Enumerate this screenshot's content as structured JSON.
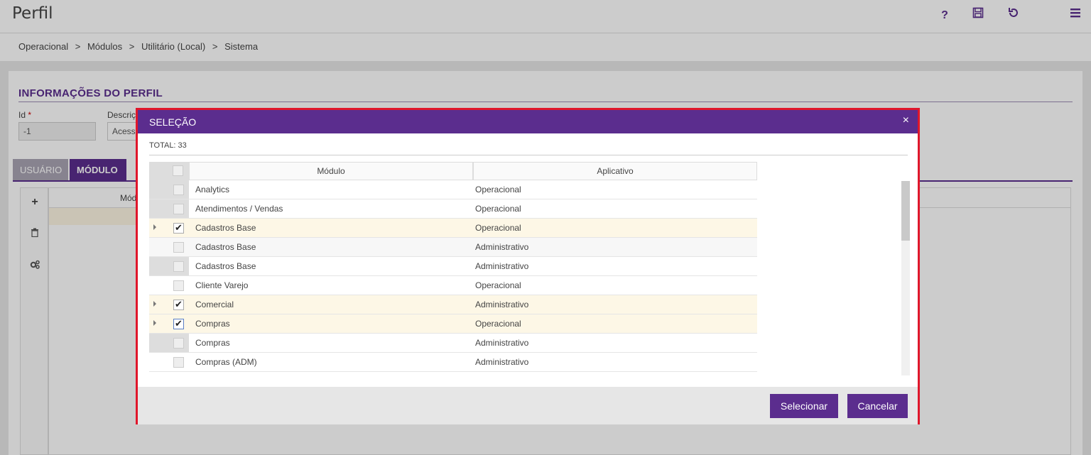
{
  "page": {
    "title": "Perfil"
  },
  "toolbar": {
    "help": "?",
    "save_icon": "save-icon",
    "refresh_icon": "refresh-icon",
    "menu_icon": "menu-icon"
  },
  "breadcrumb": [
    "Operacional",
    ">",
    "Módulos",
    ">",
    "Utilitário (Local)",
    ">",
    "Sistema"
  ],
  "form": {
    "section_title": "INFORMAÇÕES DO PERFIL",
    "id_label": "Id",
    "required_mark": "*",
    "id_value": "-1",
    "desc_label": "Descriç",
    "desc_value": "Acess"
  },
  "tabs": [
    {
      "label": "USUÁRIO"
    },
    {
      "label": "MÓDULO"
    }
  ],
  "bg_grid": {
    "header": "Mód"
  },
  "modal": {
    "title": "SELEÇÃO",
    "close": "×",
    "total": "TOTAL: 33",
    "columns": [
      "Módulo",
      "Aplicativo"
    ],
    "rows": [
      {
        "modulo": "Analytics",
        "aplicativo": "Operacional",
        "checked": false
      },
      {
        "modulo": "Atendimentos / Vendas",
        "aplicativo": "Operacional",
        "checked": false
      },
      {
        "modulo": "Cadastros Base",
        "aplicativo": "Operacional",
        "checked": true
      },
      {
        "modulo": "Cadastros Base",
        "aplicativo": "Administrativo",
        "checked": false
      },
      {
        "modulo": "Cadastros Base",
        "aplicativo": "Administrativo",
        "checked": false
      },
      {
        "modulo": "Cliente Varejo",
        "aplicativo": "Operacional",
        "checked": false
      },
      {
        "modulo": "Comercial",
        "aplicativo": "Administrativo",
        "checked": true
      },
      {
        "modulo": "Compras",
        "aplicativo": "Operacional",
        "checked": true
      },
      {
        "modulo": "Compras",
        "aplicativo": "Administrativo",
        "checked": false
      },
      {
        "modulo": "Compras (ADM)",
        "aplicativo": "Administrativo",
        "checked": false
      }
    ],
    "buttons": {
      "select": "Selecionar",
      "cancel": "Cancelar"
    },
    "colors": {
      "header": "#5b2d8e",
      "border": "#e0162b",
      "selected_row": "#fdf7e6"
    }
  }
}
